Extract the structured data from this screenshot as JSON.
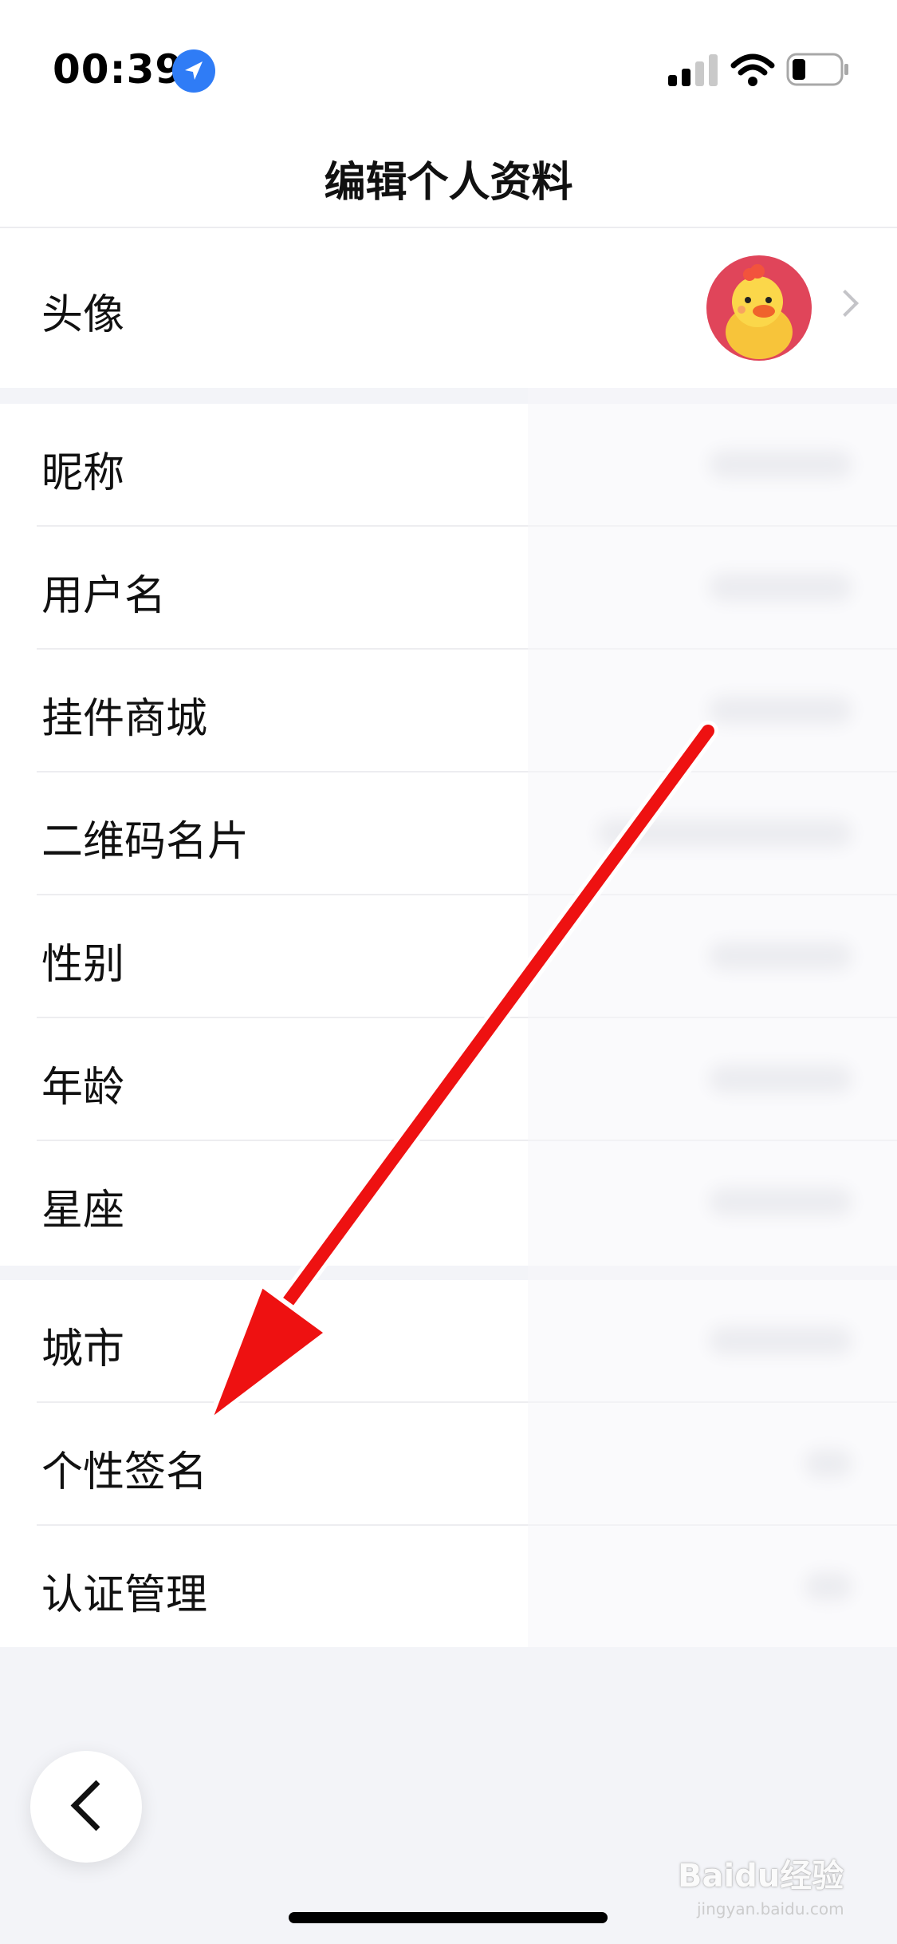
{
  "status_bar": {
    "time": "00:39"
  },
  "nav": {
    "title": "编辑个人资料"
  },
  "avatar_row": {
    "label": "头像"
  },
  "group1": [
    {
      "label": "昵称"
    },
    {
      "label": "用户名"
    },
    {
      "label": "挂件商城"
    },
    {
      "label": "二维码名片"
    },
    {
      "label": "性别"
    },
    {
      "label": "年龄"
    },
    {
      "label": "星座"
    }
  ],
  "group2": [
    {
      "label": "城市"
    },
    {
      "label": "个性签名"
    },
    {
      "label": "认证管理"
    }
  ],
  "colors": {
    "accent_blue": "#2f7cf6",
    "annotation_red": "#ee1111",
    "avatar_bg": "#e0455a"
  },
  "watermark": {
    "text": "Baidu经验",
    "sub": "jingyan.baidu.com"
  }
}
